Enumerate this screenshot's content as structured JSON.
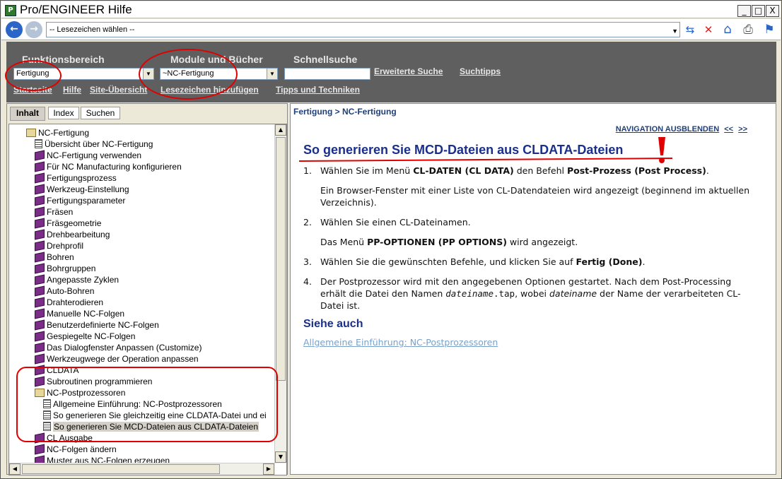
{
  "window": {
    "title": "Pro/ENGINEER Hilfe",
    "minimize": "_",
    "maximize": "□",
    "close": "X"
  },
  "toolbar": {
    "bookmark_select": "-- Lesezeichen wählen --"
  },
  "header": {
    "functional_area_label": "Funktionsbereich",
    "functional_area_value": "Fertigung",
    "modules_label": "Module und Bücher",
    "modules_value": "~NC-Fertigung",
    "quicksearch_label": "Schnellsuche",
    "quicksearch_value": "",
    "advanced_search": "Erweiterte Suche",
    "search_tips": "Suchtipps",
    "links": [
      "Startseite",
      "Hilfe",
      "Site-Übersicht",
      "Lesezeichen hinzufügen",
      "Tipps und Techniken"
    ]
  },
  "tabs": [
    "Inhalt",
    "Index",
    "Suchen"
  ],
  "tree": {
    "items": [
      {
        "label": "NC-Fertigung",
        "icon": "open-book-icon"
      },
      {
        "label": "Übersicht über NC-Fertigung",
        "icon": "document-icon"
      },
      {
        "label": "NC-Fertigung verwenden",
        "icon": "book-icon"
      },
      {
        "label": "Für NC Manufacturing konfigurieren",
        "icon": "book-icon"
      },
      {
        "label": "Fertigungsprozess",
        "icon": "book-icon"
      },
      {
        "label": "Werkzeug-Einstellung",
        "icon": "book-icon"
      },
      {
        "label": "Fertigungsparameter",
        "icon": "book-icon"
      },
      {
        "label": "Fräsen",
        "icon": "book-icon"
      },
      {
        "label": "Fräsgeometrie",
        "icon": "book-icon"
      },
      {
        "label": "Drehbearbeitung",
        "icon": "book-icon"
      },
      {
        "label": "Drehprofil",
        "icon": "book-icon"
      },
      {
        "label": "Bohren",
        "icon": "book-icon"
      },
      {
        "label": "Bohrgruppen",
        "icon": "book-icon"
      },
      {
        "label": "Angepasste Zyklen",
        "icon": "book-icon"
      },
      {
        "label": "Auto-Bohren",
        "icon": "book-icon"
      },
      {
        "label": "Drahterodieren",
        "icon": "book-icon"
      },
      {
        "label": "Manuelle NC-Folgen",
        "icon": "book-icon"
      },
      {
        "label": "Benutzerdefinierte NC-Folgen",
        "icon": "book-icon"
      },
      {
        "label": "Gespiegelte NC-Folgen",
        "icon": "book-icon"
      },
      {
        "label": "Das Dialogfenster Anpassen (Customize)",
        "icon": "book-icon"
      },
      {
        "label": "Werkzeugwege der Operation anpassen",
        "icon": "book-icon"
      },
      {
        "label": "CLDATA",
        "icon": "book-icon"
      },
      {
        "label": "Subroutinen programmieren",
        "icon": "book-icon"
      },
      {
        "label": "NC-Postprozessoren",
        "icon": "open-book-icon"
      },
      {
        "label": "Allgemeine Einführung: NC-Postprozessoren",
        "icon": "document-icon"
      },
      {
        "label": "So generieren Sie gleichzeitig eine CLDATA-Datei und ei",
        "icon": "document-icon"
      },
      {
        "label": "So generieren Sie MCD-Dateien aus CLDATA-Dateien",
        "icon": "document-icon"
      },
      {
        "label": "CL Ausgabe",
        "icon": "book-icon"
      },
      {
        "label": "NC-Folgen ändern",
        "icon": "book-icon"
      },
      {
        "label": "Muster aus NC-Folgen erzeugen",
        "icon": "book-icon"
      }
    ]
  },
  "content": {
    "breadcrumb": "Fertigung > NC-Fertigung",
    "nav_hide": "NAVIGATION AUSBLENDEN",
    "nav_prev": "<<",
    "nav_next": ">>",
    "title": "So generieren Sie MCD-Dateien aus CLDATA-Dateien",
    "steps": {
      "s1_num": "1.",
      "s1_a": "Wählen Sie im Menü ",
      "s1_b": "CL-DATEN (CL DATA)",
      "s1_c": " den Befehl ",
      "s1_d": "Post-Prozess (Post Process)",
      "s1_e": ".",
      "s1_note": "Ein Browser-Fenster mit einer Liste von CL-Datendateien wird angezeigt (beginnend im aktuellen Verzeichnis).",
      "s2_num": "2.",
      "s2_text": "Wählen Sie einen CL-Dateinamen.",
      "s2_note_a": "Das Menü ",
      "s2_note_b": "PP-OPTIONEN (PP OPTIONS)",
      "s2_note_c": " wird angezeigt.",
      "s3_num": "3.",
      "s3_a": "Wählen Sie die gewünschten Befehle, und klicken Sie auf ",
      "s3_b": "Fertig (Done)",
      "s3_c": ".",
      "s4_num": "4.",
      "s4_a": "Der Postprozessor wird mit den angegebenen Optionen gestartet. Nach dem Post-Processing erhält die Datei den Namen ",
      "s4_b": "dateiname",
      "s4_c": ".tap",
      "s4_d": ", wobei ",
      "s4_e": "dateiname",
      "s4_f": " der Name der verarbeiteten CL-Datei ist."
    },
    "see_also": "Siehe auch",
    "see_also_link": "Allgemeine Einführung: NC-Postprozessoren"
  },
  "colors": {
    "header_bg": "#5f5f5f",
    "title_blue": "#1a2f8a",
    "annotation_red": "#e00000"
  }
}
